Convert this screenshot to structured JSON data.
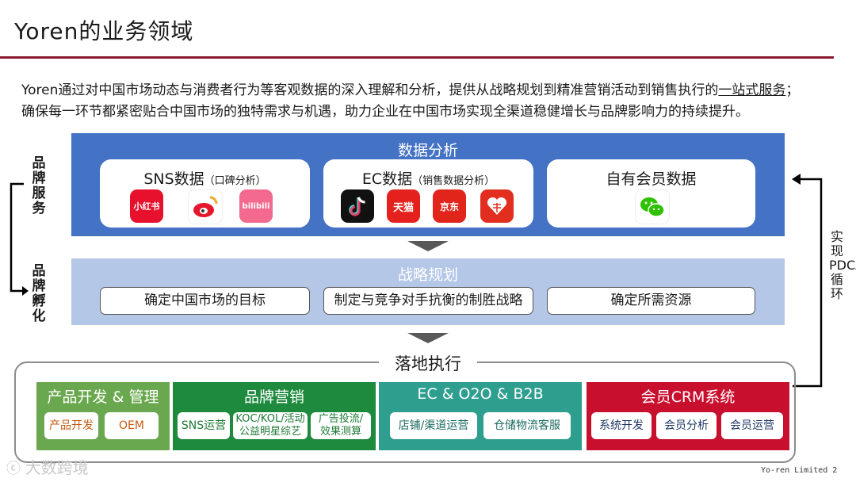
{
  "title": "Yoren的业务领域",
  "intro": {
    "line1_pre": "Yoren通过对中国市场动态与消费者行为等客观数据的深入理解和分析，提供从战略规划到精准营销活动到销售执行的",
    "line1_link": "一站式服务",
    "line1_post": "；",
    "line2": "确保每一环节都紧密贴合中国市场的独特需求与机遇，助力企业在中国市场实现全渠道稳健增长与品牌影响力的持续提升。"
  },
  "left_labels": {
    "brand_service": "品牌服务",
    "brand_incubation": "品牌孵化"
  },
  "right_label": "实现 PDCA 循环",
  "data_analysis": {
    "title": "数据分析",
    "cards": [
      {
        "title": "SNS数据",
        "sub": "（口碑分析）",
        "apps": [
          "小红书",
          "微博",
          "bilibili"
        ]
      },
      {
        "title": "EC数据",
        "sub": "（销售数据分析）",
        "apps": [
          "抖音",
          "天猫",
          "京东",
          "拼多多"
        ]
      },
      {
        "title": "自有会员数据",
        "sub": "",
        "apps": [
          "微信"
        ]
      }
    ]
  },
  "strategy": {
    "title": "战略规划",
    "items": [
      "确定中国市场的目标",
      "制定与竞争对手抗衡的制胜战略",
      "确定所需资源"
    ]
  },
  "execution": {
    "title": "落地执行",
    "columns": [
      {
        "title": "产品开发 & 管理",
        "color": "#6aa84f",
        "chip_text": "#c55a11",
        "chips": [
          "产品开发",
          "OEM"
        ]
      },
      {
        "title": "品牌营销",
        "color": "#1e8a3e",
        "chip_text": "#1e7a35",
        "chips": [
          "SNS运营",
          "KOC/KOL/活动\n公益明星综艺",
          "广告投流/\n效果测算"
        ]
      },
      {
        "title": "EC & O2O & B2B",
        "color": "#2e9e8f",
        "chip_text": "#1b6b61",
        "chips": [
          "店铺/渠道运营",
          "仓储物流客服"
        ]
      },
      {
        "title": "会员CRM系统",
        "color": "#c8102e",
        "chip_text": "#1f3864",
        "chips": [
          "系统开发",
          "会员分析",
          "会员运营"
        ]
      }
    ]
  },
  "watermark": "大数跨境",
  "footer": "Yo-ren Limited  2"
}
